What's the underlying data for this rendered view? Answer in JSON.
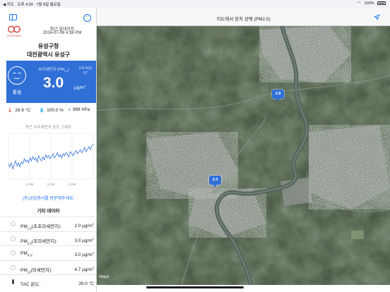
{
  "status_bar": {
    "back_label": "◀ 지도",
    "time": "오후 4:39",
    "date": "7월 8일 월요일",
    "battery": "100%"
  },
  "sidebar": {
    "logo_text": "OOSensors",
    "update_label": "최근 업데이트",
    "update_time": "2024-07-08 4:38 PM",
    "location_line1": "유성구청",
    "location_line2": "대전광역시 유성구",
    "pm_card": {
      "grade": "좋음",
      "title_prefix": "초미세먼지 (PM",
      "title_sub": "2.5",
      "title_suffix": ")",
      "aqi_label": "US AQI",
      "aqi_value": "37",
      "value": "3.0",
      "unit_base": "μg/m",
      "unit_exp": "3",
      "color": "#2f6fd6"
    },
    "environment": {
      "temperature": "26.9 °C",
      "humidity": "100.0 %",
      "pressure": "998 hPa"
    },
    "graph_title": "최근 초미세먼지 농도 그래프",
    "chart_data": {
      "type": "line",
      "title": "최근 초미세먼지 농도 그래프",
      "x_tick_labels": [
        "2 PM",
        "3 PM",
        "4 PM"
      ],
      "x": [
        0,
        1,
        2,
        3,
        4,
        5,
        6,
        7,
        8,
        9,
        10,
        11,
        12,
        13,
        14,
        15,
        16,
        17,
        18,
        19,
        20,
        21,
        22,
        23,
        24,
        25,
        26,
        27,
        28,
        29,
        30,
        31,
        32,
        33,
        34,
        35,
        36,
        37,
        38,
        39,
        40,
        41,
        42,
        43,
        44,
        45,
        46,
        47,
        48,
        49,
        50,
        51,
        52,
        53,
        54,
        55,
        56,
        57,
        58,
        59
      ],
      "values": [
        1.5,
        1.2,
        1.6,
        1.0,
        1.4,
        1.8,
        1.3,
        1.6,
        1.2,
        1.7,
        1.5,
        2.0,
        1.7,
        1.9,
        1.6,
        2.1,
        1.8,
        2.2,
        1.9,
        2.1,
        1.7,
        2.3,
        2.0,
        1.8,
        2.2,
        1.9,
        2.4,
        2.1,
        2.3,
        2.0,
        2.2,
        2.5,
        2.1,
        2.3,
        2.6,
        2.2,
        2.4,
        2.1,
        2.5,
        2.3,
        2.6,
        2.4,
        2.2,
        2.7,
        2.5,
        2.3,
        2.6,
        2.8,
        2.5,
        2.7,
        2.9,
        2.6,
        2.8,
        3.1,
        2.7,
        2.9,
        3.2,
        2.9,
        3.3,
        3.4
      ],
      "ylim": [
        0,
        4.5
      ],
      "grid": true,
      "line_color": "#2f6fd6"
    },
    "link_text": "(주)공감센서를 방문해주세요.",
    "other_title": "기타 데이터",
    "other_data": [
      {
        "label_pre": "PM",
        "label_sub": "1.0",
        "label_post": "(초초미세먼지):",
        "value": "2.0 μg/m",
        "unit_exp": "3"
      },
      {
        "label_pre": "PM",
        "label_sub": "2.5",
        "label_post": "(초미세먼지):",
        "value": "3.0 μg/m",
        "unit_exp": "3"
      },
      {
        "label_pre": "PM",
        "label_sub": "4.0",
        "label_post": ":",
        "value": "3.0 μg/m",
        "unit_exp": "3"
      },
      {
        "label_pre": "PM",
        "label_sub": "10",
        "label_post": "(미세먼지):",
        "value": "4.7 μg/m",
        "unit_exp": "3"
      },
      {
        "label_pre": "TAC 온도",
        "label_sub": "",
        "label_post": ":",
        "value": "39.0 °C",
        "unit_exp": ""
      }
    ]
  },
  "map": {
    "title": "지도에서 장치 선택 (PM2.5)",
    "pins": [
      {
        "label": "2.8"
      },
      {
        "label": "3.3"
      }
    ],
    "brand": "Maps"
  }
}
